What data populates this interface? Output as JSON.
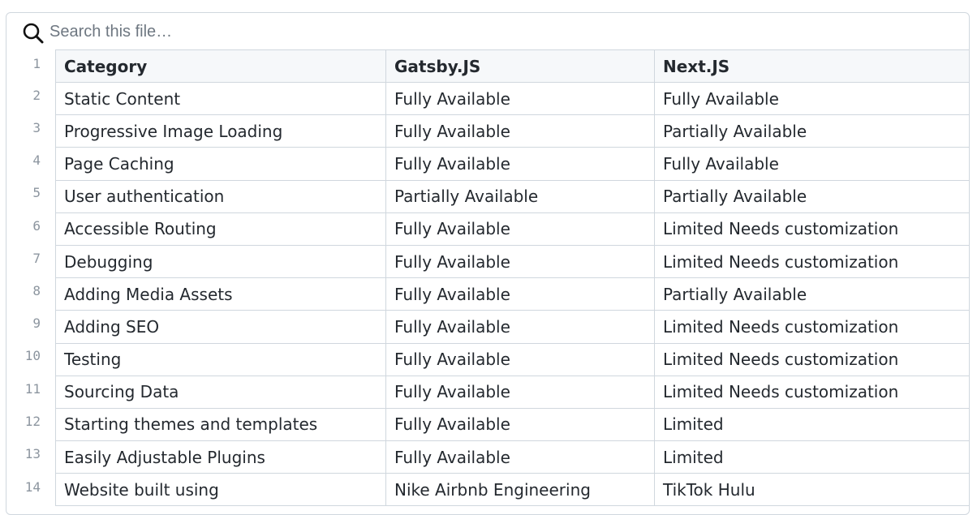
{
  "search": {
    "placeholder": "Search this file…"
  },
  "line_numbers": [
    "1",
    "2",
    "3",
    "4",
    "5",
    "6",
    "7",
    "8",
    "9",
    "10",
    "11",
    "12",
    "13",
    "14"
  ],
  "table": {
    "headers": [
      "Category",
      "Gatsby.JS",
      "Next.JS"
    ],
    "rows": [
      [
        "Static Content",
        "Fully Available",
        "Fully Available"
      ],
      [
        "Progressive Image Loading",
        "Fully Available",
        "Partially Available"
      ],
      [
        "Page Caching",
        "Fully Available",
        "Fully Available"
      ],
      [
        "User authentication",
        "Partially Available",
        "Partially Available"
      ],
      [
        "Accessible Routing",
        "Fully Available",
        "Limited Needs customization"
      ],
      [
        "Debugging",
        "Fully Available",
        "Limited Needs customization"
      ],
      [
        "Adding Media Assets",
        "Fully Available",
        "Partially Available"
      ],
      [
        "Adding SEO",
        "Fully Available",
        "Limited Needs customization"
      ],
      [
        "Testing",
        "Fully Available",
        "Limited Needs customization"
      ],
      [
        "Sourcing Data",
        "Fully Available",
        "Limited Needs customization"
      ],
      [
        "Starting themes and templates",
        "Fully Available",
        "Limited"
      ],
      [
        "Easily Adjustable Plugins",
        "Fully Available",
        "Limited"
      ],
      [
        "Website built using",
        "Nike Airbnb Engineering",
        "TikTok Hulu"
      ]
    ]
  },
  "icons": {
    "search": "search-icon"
  },
  "colors": {
    "border": "#d0d7de",
    "header_bg": "#f6f8fa",
    "text": "#24292f",
    "line_number": "#8c959f",
    "placeholder": "#6e7781"
  }
}
